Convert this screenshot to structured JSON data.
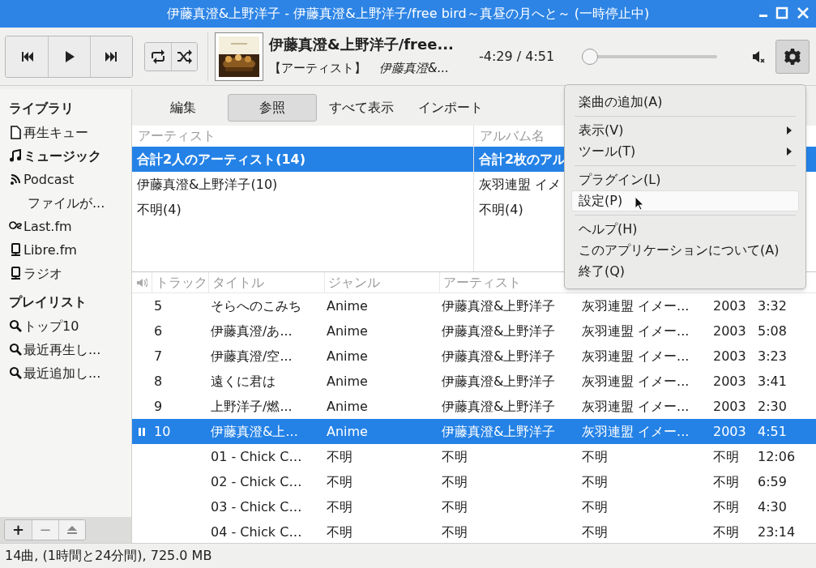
{
  "window": {
    "title": "伊藤真澄&上野洋子 - 伊藤真澄&上野洋子/free bird～真昼の月へと～ (一時停止中)"
  },
  "toolbar": {
    "now_playing": {
      "title": "伊藤真澄&上野洋子/free...",
      "label": "【アーティスト】",
      "artist": "伊藤真澄&..."
    },
    "time": "-4:29 / 4:51",
    "position": {
      "level": 0.05
    },
    "muted": true,
    "settings_pressed": true
  },
  "sidebar": {
    "sections": [
      {
        "title": "ライブラリ",
        "items": [
          {
            "kind": "file",
            "label": "再生キュー",
            "selected": false
          },
          {
            "kind": "music",
            "label": "ミュージック",
            "selected": true
          },
          {
            "kind": "rss",
            "label": "Podcast",
            "selected": false,
            "children": [
              {
                "label": "ファイルが...",
                "selected": false
              }
            ]
          },
          {
            "kind": "lastfm",
            "label": "Last.fm",
            "selected": false
          },
          {
            "kind": "device",
            "label": "Libre.fm",
            "selected": false
          },
          {
            "kind": "device",
            "label": "ラジオ",
            "selected": false
          }
        ]
      },
      {
        "title": "プレイリスト",
        "items": [
          {
            "kind": "search",
            "label": "トップ10",
            "selected": false
          },
          {
            "kind": "search",
            "label": "最近再生し...",
            "selected": false
          },
          {
            "kind": "search",
            "label": "最近追加し...",
            "selected": false
          }
        ]
      }
    ],
    "buttons": [
      "+",
      "−"
    ]
  },
  "tabs": [
    {
      "label": "編集",
      "selected": false
    },
    {
      "label": "参照",
      "selected": true
    },
    {
      "label": "すべて表示",
      "selected": false
    },
    {
      "label": "インポート",
      "selected": false
    }
  ],
  "browser": {
    "columns": [
      "アーティスト",
      "アルバム名"
    ],
    "rows": [
      {
        "artist": "合計2人のアーティスト(14)",
        "album": "合計2枚のアル",
        "selected": true
      },
      {
        "artist": "伊藤真澄&上野洋子(10)",
        "album": "灰羽連盟 イメ",
        "selected": false
      },
      {
        "artist": "不明(4)",
        "album": "不明(4)",
        "selected": false
      }
    ]
  },
  "tracks": {
    "columns": [
      "トラック",
      "タイトル",
      "ジャンル",
      "アーティスト"
    ],
    "rows": [
      {
        "track": "5",
        "title": "そらへのこみち",
        "genre": "Anime",
        "artist": "伊藤真澄&上野洋子",
        "album": "灰羽連盟 イメー...",
        "year": "2003",
        "length": "3:32",
        "selected": false,
        "paused": false
      },
      {
        "track": "6",
        "title": "伊藤真澄/あ...",
        "genre": "Anime",
        "artist": "伊藤真澄&上野洋子",
        "album": "灰羽連盟 イメー...",
        "year": "2003",
        "length": "5:08",
        "selected": false,
        "paused": false
      },
      {
        "track": "7",
        "title": "伊藤真澄/空...",
        "genre": "Anime",
        "artist": "伊藤真澄&上野洋子",
        "album": "灰羽連盟 イメー...",
        "year": "2003",
        "length": "3:23",
        "selected": false,
        "paused": false
      },
      {
        "track": "8",
        "title": "遠くに君は",
        "genre": "Anime",
        "artist": "伊藤真澄&上野洋子",
        "album": "灰羽連盟 イメー...",
        "year": "2003",
        "length": "3:41",
        "selected": false,
        "paused": false
      },
      {
        "track": "9",
        "title": "上野洋子/燃...",
        "genre": "Anime",
        "artist": "伊藤真澄&上野洋子",
        "album": "灰羽連盟 イメー...",
        "year": "2003",
        "length": "2:30",
        "selected": false,
        "paused": false
      },
      {
        "track": "10",
        "title": "伊藤真澄&上...",
        "genre": "Anime",
        "artist": "伊藤真澄&上野洋子",
        "album": "灰羽連盟 イメー...",
        "year": "2003",
        "length": "4:51",
        "selected": true,
        "paused": true
      },
      {
        "track": "",
        "title": "01 - Chick C…",
        "genre": "不明",
        "artist": "不明",
        "album": "不明",
        "year": "不明",
        "length": "12:06",
        "selected": false,
        "paused": false
      },
      {
        "track": "",
        "title": "02 - Chick C…",
        "genre": "不明",
        "artist": "不明",
        "album": "不明",
        "year": "不明",
        "length": "6:59",
        "selected": false,
        "paused": false
      },
      {
        "track": "",
        "title": "03 - Chick C…",
        "genre": "不明",
        "artist": "不明",
        "album": "不明",
        "year": "不明",
        "length": "4:30",
        "selected": false,
        "paused": false
      },
      {
        "track": "",
        "title": "04 - Chick C…",
        "genre": "不明",
        "artist": "不明",
        "album": "不明",
        "year": "不明",
        "length": "23:14",
        "selected": false,
        "paused": false
      }
    ]
  },
  "menu": {
    "items": [
      {
        "kind": "item",
        "label": "楽曲の追加(A)",
        "highlighted": false
      },
      {
        "kind": "separator"
      },
      {
        "kind": "submenu",
        "label": "表示(V)",
        "highlighted": false
      },
      {
        "kind": "submenu",
        "label": "ツール(T)",
        "highlighted": false
      },
      {
        "kind": "separator"
      },
      {
        "kind": "item",
        "label": "プラグイン(L)",
        "highlighted": false
      },
      {
        "kind": "item",
        "label": "設定(P)",
        "highlighted": true
      },
      {
        "kind": "separator"
      },
      {
        "kind": "item",
        "label": "ヘルプ(H)",
        "highlighted": false
      },
      {
        "kind": "item",
        "label": "このアプリケーションについて(A)",
        "highlighted": false
      },
      {
        "kind": "item",
        "label": "終了(Q)",
        "highlighted": false
      }
    ]
  },
  "status_bar": "14曲, (1時間と24分間), 725.0 MB"
}
